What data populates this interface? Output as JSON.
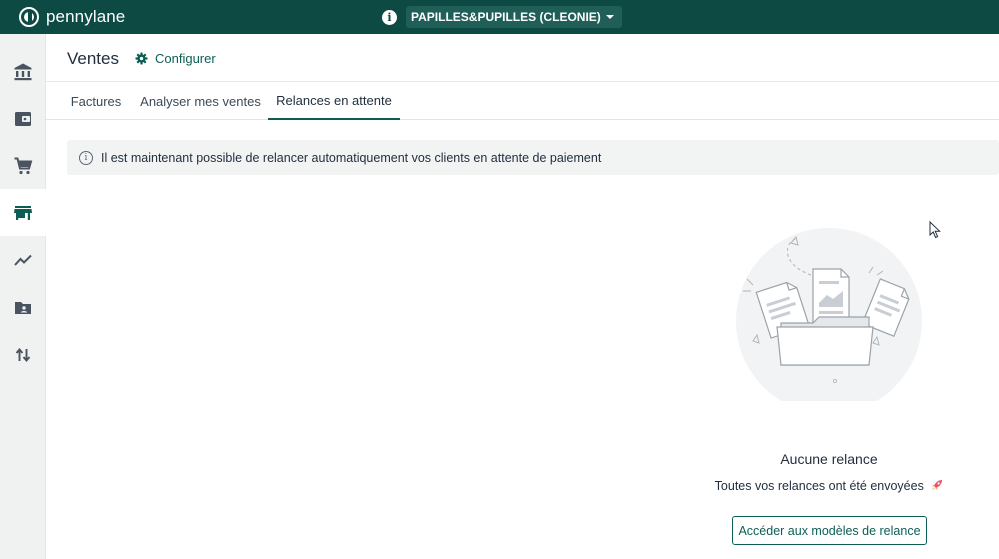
{
  "topbar": {
    "logo_text": "pennylane",
    "company_name": "PAPILLES&PUPILLES (CLEONIE)",
    "info_icon": "info-icon",
    "background": "#0c4a43"
  },
  "sidebar": {
    "items": [
      {
        "icon": "bank-icon"
      },
      {
        "icon": "wallet-icon"
      },
      {
        "icon": "cart-icon"
      },
      {
        "icon": "store-icon",
        "active": true
      },
      {
        "icon": "trend-icon"
      },
      {
        "icon": "contacts-folder-icon"
      },
      {
        "icon": "transfer-arrows-icon"
      }
    ]
  },
  "header": {
    "title": "Ventes",
    "configure_label": "Configurer"
  },
  "tabs": [
    {
      "label": "Factures"
    },
    {
      "label": "Analyser mes ventes"
    },
    {
      "label": "Relances en attente",
      "active": true
    }
  ],
  "banner": {
    "text": "Il est maintenant possible de relancer automatiquement vos clients en attente de paiement"
  },
  "empty_state": {
    "title": "Aucune relance",
    "subtitle": "Toutes vos relances ont été envoyées",
    "button_label": "Accéder aux modèles de relance"
  },
  "colors": {
    "accent": "#0c5e55",
    "sidebar_bg": "#f0f2f2",
    "banner_bg": "#f2f4f4"
  }
}
